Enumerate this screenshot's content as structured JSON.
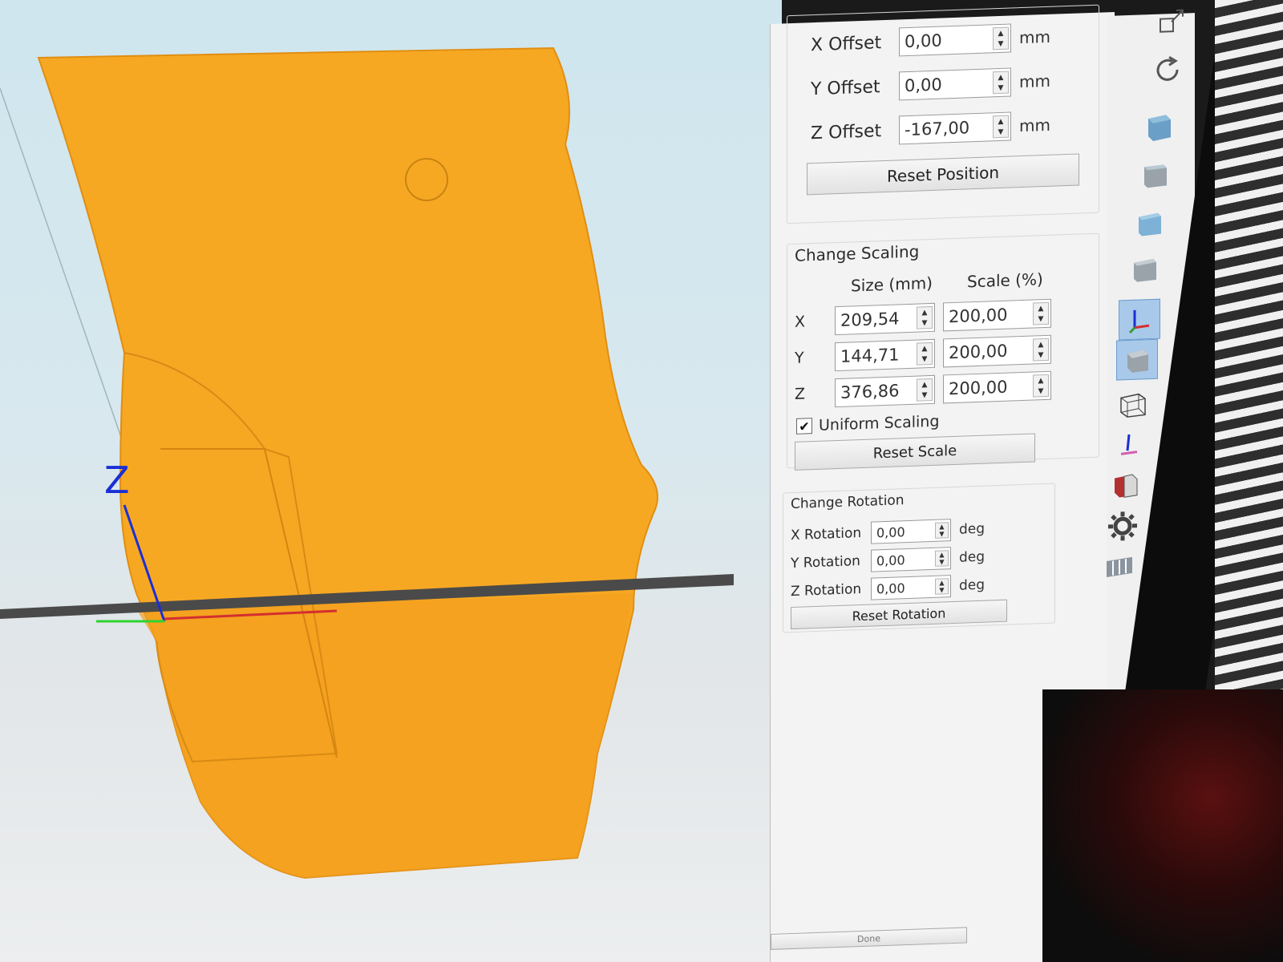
{
  "viewport": {
    "axis_label": "Z"
  },
  "position": {
    "x_offset": {
      "label": "X Offset",
      "value": "0,00",
      "unit": "mm"
    },
    "y_offset": {
      "label": "Y Offset",
      "value": "0,00",
      "unit": "mm"
    },
    "z_offset": {
      "label": "Z Offset",
      "value": "-167,00",
      "unit": "mm"
    },
    "reset_label": "Reset Position"
  },
  "scaling": {
    "title": "Change Scaling",
    "size_header": "Size (mm)",
    "scale_header": "Scale (%)",
    "rows": [
      {
        "axis": "X",
        "size": "209,54",
        "scale": "200,00"
      },
      {
        "axis": "Y",
        "size": "144,71",
        "scale": "200,00"
      },
      {
        "axis": "Z",
        "size": "376,86",
        "scale": "200,00"
      }
    ],
    "uniform_label": "Uniform Scaling",
    "uniform_checked": true,
    "reset_label": "Reset Scale"
  },
  "rotation": {
    "title": "Change Rotation",
    "x": {
      "label": "X Rotation",
      "value": "0,00",
      "unit": "deg"
    },
    "y": {
      "label": "Y Rotation",
      "value": "0,00",
      "unit": "deg"
    },
    "z": {
      "label": "Z Rotation",
      "value": "0,00",
      "unit": "deg"
    },
    "reset_label": "Reset Rotation"
  },
  "footer": {
    "done_label": "Done"
  },
  "colors": {
    "model": "#f7a823",
    "model_shade": "#e6951a",
    "axis_z": "#1a2fd6",
    "active_tool": "#a9c9ea"
  },
  "toolbar_icons": [
    "zoom-fit-icon",
    "rotate-view-icon",
    "view-iso-icon",
    "view-front-icon",
    "view-side-icon",
    "view-top-icon",
    "axes-icon",
    "solid-cube-icon",
    "wireframe-cube-icon",
    "pointer-icon",
    "section-cube-icon",
    "settings-gear-icon",
    "slicer-icon"
  ]
}
